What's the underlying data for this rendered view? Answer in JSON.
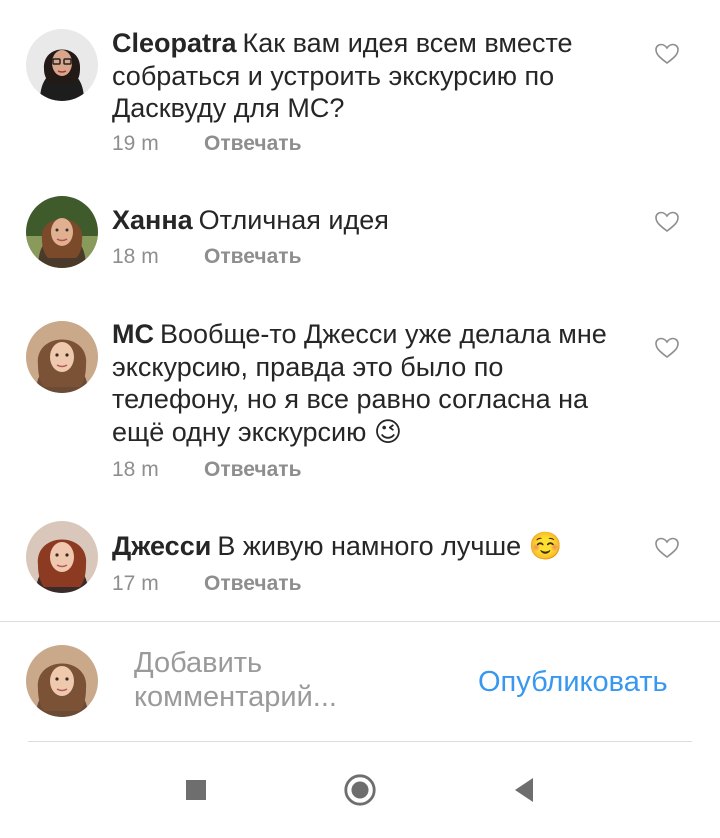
{
  "comments": [
    {
      "user": "Cleopatra",
      "text": "Как вам идея всем вместе собраться и устроить экскурсию по Дасквуду для МС?",
      "time": "19 m",
      "reply": "Отвечать",
      "avatar_icon": "avatar-woman-glasses-icon"
    },
    {
      "user": "Ханна",
      "text": "Отличная идея",
      "time": "18 m",
      "reply": "Отвечать",
      "avatar_icon": "avatar-woman-outdoor-icon"
    },
    {
      "user": "МС",
      "text": "Вообще-то Джесси уже делала мне экскурсию, правда это было по телефону, но я все равно согласна на ещё одну экскурсию",
      "emoji": "😉",
      "time": "18 m",
      "reply": "Отвечать",
      "avatar_icon": "avatar-woman-brown-hair-icon"
    },
    {
      "user": "Джесси",
      "text": "В живую намного лучше",
      "emoji": "☺️",
      "time": "17 m",
      "reply": "Отвечать",
      "avatar_icon": "avatar-woman-red-hair-icon"
    }
  ],
  "composer": {
    "placeholder": "Добавить комментарий...",
    "publish_label": "Опубликовать",
    "avatar_icon": "avatar-woman-brown-hair-icon"
  },
  "navbar": {
    "icons": [
      "recents-square-icon",
      "home-circle-icon",
      "back-triangle-icon"
    ]
  },
  "colors": {
    "text": "#262626",
    "meta": "#8e8e8e",
    "accent": "#3897f0",
    "divider": "#dbdbdb",
    "navbar_icons": "#6e6e6e"
  }
}
